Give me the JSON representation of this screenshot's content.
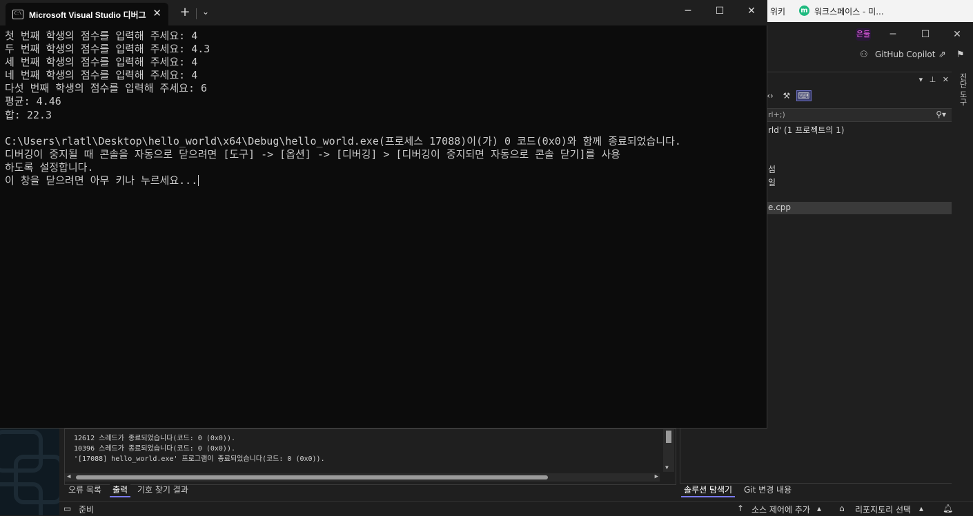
{
  "browser_strip": {
    "wiki": "위키",
    "workspace_icon": "m",
    "workspace_label": "워크스페이스 - 미..."
  },
  "vs": {
    "user_badge": "은둘",
    "minimize": "─",
    "maximize": "☐",
    "close": "✕",
    "copilot_label": "GitHub Copilot",
    "right_vertical_label": "진단 도구",
    "solution_explorer": {
      "search_text": "rl+;)",
      "tree_rows": [
        "rld' (1 프로젝트의 1)",
        "섬",
        "일",
        "e.cpp"
      ]
    },
    "output": {
      "lines": [
        "12612 스레드가 종료되었습니다(코드: 0 (0x0)).",
        "10396 스레드가 종료되었습니다(코드: 0 (0x0)).",
        "'[17088] hello_world.exe' 프로그램이 종료되었습니다(코드: 0 (0x0))."
      ]
    },
    "bottom_tabs": [
      "오류 목록",
      "출력",
      "기호 찾기 결과"
    ],
    "solution_tabs": [
      "솔루션 탐색기",
      "Git 변경 내용"
    ],
    "status": {
      "ready": "준비",
      "source_control": "소스 제어에 추가",
      "repository": "리포지토리 선택"
    }
  },
  "console": {
    "tab_title": "Microsoft Visual Studio 디버그",
    "lines": [
      "첫 번째 학생의 점수를 입력해 주세요: 4",
      "두 번째 학생의 점수를 입력해 주세요: 4.3",
      "세 번째 학생의 점수를 입력해 주세요: 4",
      "네 번째 학생의 점수를 입력해 주세요: 4",
      "다섯 번째 학생의 점수를 입력해 주세요: 6",
      "평균: 4.46",
      "합: 22.3",
      "",
      "C:\\Users\\rlatl\\Desktop\\hello_world\\x64\\Debug\\hello_world.exe(프로세스 17088)이(가) 0 코드(0x0)와 함께 종료되었습니다.",
      "디버깅이 중지될 때 콘솔을 자동으로 닫으려면 [도구] -> [옵션] -> [디버깅] > [디버깅이 중지되면 자동으로 콘솔 닫기]를 사용",
      "하도록 설정합니다.",
      "이 창을 닫으려면 아무 키나 누르세요..."
    ]
  }
}
